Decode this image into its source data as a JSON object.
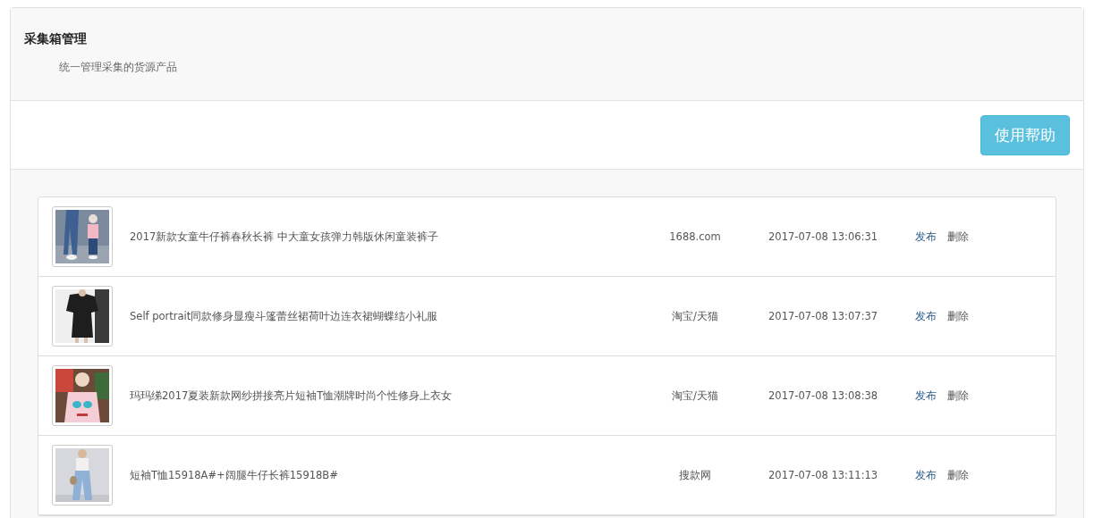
{
  "header": {
    "title": "采集箱管理",
    "subtitle": "统一管理采集的货源产品"
  },
  "toolbar": {
    "help_button": "使用帮助"
  },
  "products": [
    {
      "title": "2017新款女童牛仔裤春秋长裤 中大童女孩弹力韩版休闲童装裤子",
      "source": "1688.com",
      "time": "2017-07-08 13:06:31",
      "actions": [
        "发布",
        "删除"
      ]
    },
    {
      "title": "Self portrait同款修身显瘦斗篷蕾丝裙荷叶边连衣裙蝴蝶结小礼服",
      "source": "淘宝/天猫",
      "time": "2017-07-08 13:07:37",
      "actions": [
        "发布",
        "删除"
      ]
    },
    {
      "title": "玛玛绨2017夏装新款网纱拼接亮片短袖T恤潮牌时尚个性修身上衣女",
      "source": "淘宝/天猫",
      "time": "2017-07-08 13:08:38",
      "actions": [
        "发布",
        "删除"
      ]
    },
    {
      "title": "短袖T恤15918A#+阔腿牛仔长裤15918B#",
      "source": "搜款网",
      "time": "2017-07-08 13:11:13",
      "actions": [
        "发布",
        "删除"
      ]
    }
  ]
}
